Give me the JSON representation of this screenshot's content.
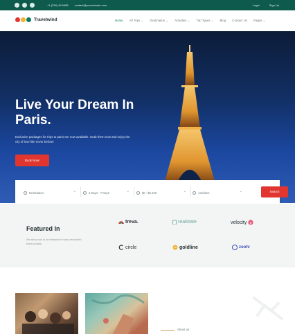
{
  "topbar": {
    "social_icons": [
      "facebook-icon",
      "twitter-icon",
      "instagram-icon"
    ],
    "phone": "+1 (234) 45 6485",
    "email": "contact@yourdomain.com",
    "login": "Login",
    "signup": "Sign Up"
  },
  "nav": {
    "logo_text": "Travelwind",
    "logo_colors": [
      "#e0362f",
      "#f2b233",
      "#0e7b61"
    ],
    "menu": [
      {
        "label": "Home",
        "active": true
      },
      {
        "label": "All Trips ⌄"
      },
      {
        "label": "Destination ⌄"
      },
      {
        "label": "Activities ⌄"
      },
      {
        "label": "Trip Types ⌄"
      },
      {
        "label": "Blog"
      },
      {
        "label": "Contact Us"
      },
      {
        "label": "Pages ⌄"
      }
    ]
  },
  "hero": {
    "title": "Live Your Dream In Paris.",
    "subtitle": "Exclusive packages for trips to paris are now available. Grab them now and enjoy the city of love like never before!",
    "cta": "Book Now!"
  },
  "search": {
    "destination": "Destination",
    "duration": "4 Days - 7 Days",
    "price": "$0 - $2,100",
    "activities": "Activities",
    "button": "Search"
  },
  "featured": {
    "title": "Featured In",
    "description": "We are proud to be featured in many renowned travel portals.",
    "brands": [
      "treva.",
      "realstate",
      "velocity",
      "circle",
      "goldline",
      "zootv"
    ]
  },
  "about": {
    "label": "About us"
  },
  "colors": {
    "accent_red": "#e0362f",
    "brand_green": "#0e5a4d",
    "link_green": "#0e7b61"
  }
}
